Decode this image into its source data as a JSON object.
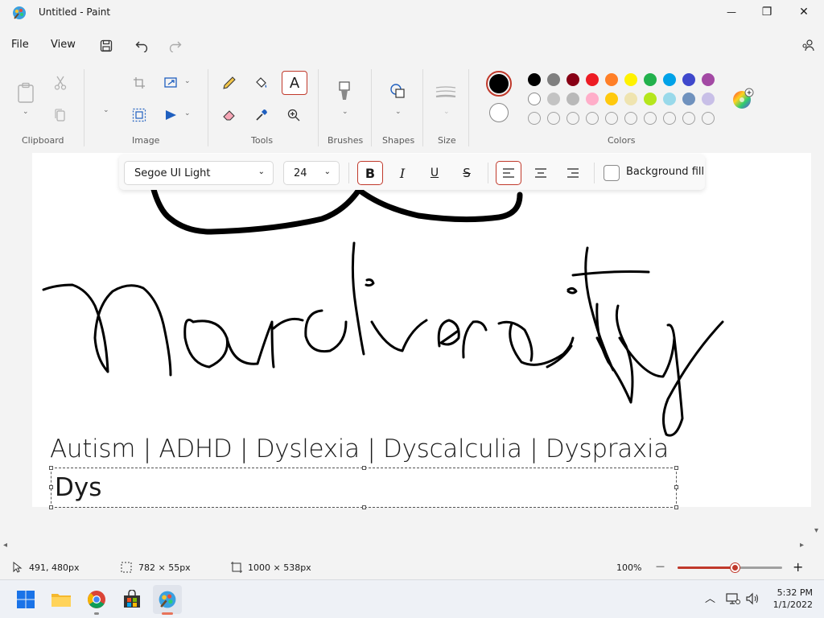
{
  "window": {
    "title": "Untitled - Paint",
    "minimize": "—",
    "maximize": "❐",
    "close": "✕"
  },
  "menu": {
    "file": "File",
    "view": "View"
  },
  "ribbon": {
    "groups": {
      "clipboard": "Clipboard",
      "image": "Image",
      "tools": "Tools",
      "brushes": "Brushes",
      "shapes": "Shapes",
      "size": "Size",
      "colors": "Colors"
    },
    "text_tool_glyph": "A"
  },
  "palette": {
    "primary": "#000000",
    "secondary": "#ffffff",
    "row1": [
      "#000000",
      "#7f7f7f",
      "#880015",
      "#ed1c24",
      "#ff7f27",
      "#fff200",
      "#22b14c",
      "#00a2e8",
      "#3f48cc",
      "#a349a4"
    ],
    "row2": [
      "#ffffff",
      "#c3c3c3",
      "#b9b9b9",
      "#ffaec9",
      "#ffc90e",
      "#efe4b0",
      "#b5e61d",
      "#99d9ea",
      "#7092be",
      "#c8bfe7"
    ],
    "row3_count": 10
  },
  "textbar": {
    "font": "Segoe UI Light",
    "size": "24",
    "bold": "B",
    "italic": "I",
    "underline": "U",
    "strike": "S",
    "background_fill": "Background fill"
  },
  "canvas": {
    "line1": "Autism | ADHD | Dyslexia | Dyscalculia | Dyspraxia",
    "line2": "Dys"
  },
  "status": {
    "cursor": "491, 480px",
    "selection": "782 × 55px",
    "canvas_size": "1000 × 538px",
    "zoom": "100%",
    "zoom_minus": "—",
    "zoom_plus": "+",
    "zoom_level": 0.55
  },
  "taskbar": {
    "time": "5:32 PM",
    "date": "1/1/2022"
  }
}
